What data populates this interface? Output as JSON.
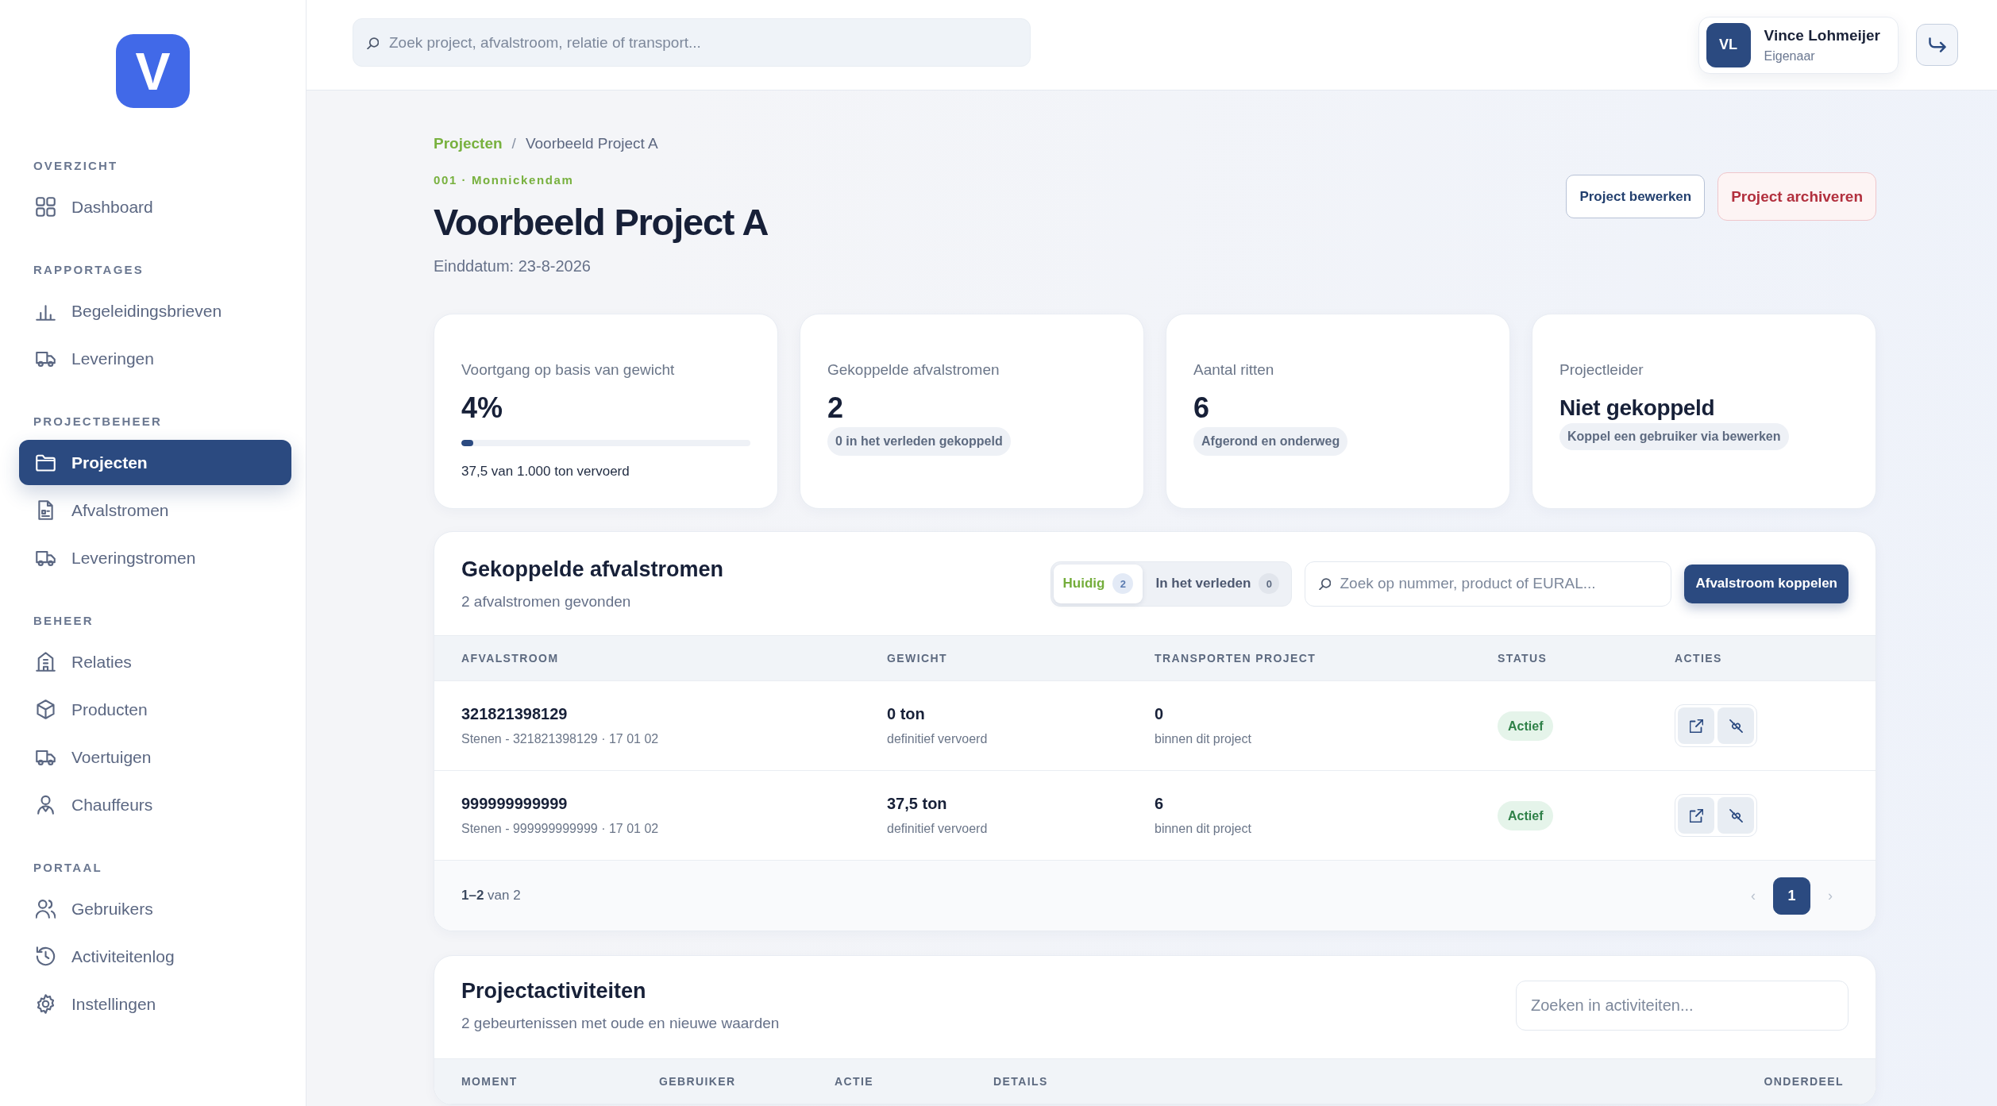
{
  "sidebar": {
    "logo": "V",
    "sections": [
      {
        "title": "OVERZICHT",
        "items": [
          {
            "label": "Dashboard",
            "selected": false
          }
        ]
      },
      {
        "title": "RAPPORTAGES",
        "items": [
          {
            "label": "Begeleidingsbrieven",
            "selected": false
          },
          {
            "label": "Leveringen",
            "selected": false
          }
        ]
      },
      {
        "title": "PROJECTBEHEER",
        "items": [
          {
            "label": "Projecten",
            "selected": true
          },
          {
            "label": "Afvalstromen",
            "selected": false
          },
          {
            "label": "Leveringstromen",
            "selected": false
          }
        ]
      },
      {
        "title": "BEHEER",
        "items": [
          {
            "label": "Relaties",
            "selected": false
          },
          {
            "label": "Producten",
            "selected": false
          },
          {
            "label": "Voertuigen",
            "selected": false
          },
          {
            "label": "Chauffeurs",
            "selected": false
          }
        ]
      },
      {
        "title": "PORTAAL",
        "items": [
          {
            "label": "Gebruikers",
            "selected": false
          },
          {
            "label": "Activiteitenlog",
            "selected": false
          },
          {
            "label": "Instellingen",
            "selected": false
          }
        ]
      }
    ]
  },
  "topbar": {
    "search": {
      "placeholder": "Zoek project, afvalstroom, relatie of transport..."
    },
    "user": {
      "initials": "VL",
      "name": "Vince Lohmeijer",
      "role": "Eigenaar"
    }
  },
  "breadcrumb": {
    "items": [
      "Projecten",
      "Voorbeeld Project A"
    ],
    "separator": "/"
  },
  "project": {
    "code": "001 · Monnickendam",
    "title": "Voorbeeld Project A",
    "end_date": "Einddatum: 23-8-2026",
    "actions": [
      {
        "label": "Project bewerken",
        "kind": "secondary"
      },
      {
        "label": "Project archiveren",
        "kind": "danger"
      }
    ]
  },
  "stats": [
    {
      "kind": "progress",
      "label": "Voortgang op basis van gewicht",
      "value": "4%",
      "level": 0.04,
      "note": "37,5 van 1.000 ton vervoerd"
    },
    {
      "kind": "count",
      "label": "Gekoppelde afvalstromen",
      "value": "2",
      "pill": "0 in het verleden gekoppeld"
    },
    {
      "kind": "count",
      "label": "Aantal ritten",
      "value": "6",
      "pill": "Afgerond en onderweg"
    },
    {
      "kind": "text",
      "label": "Projectleider",
      "value": "Niet gekoppeld",
      "pill": "Koppel een gebruiker via bewerken"
    }
  ],
  "waste_streams": {
    "title": "Gekoppelde afvalstromen",
    "subtitle": "2 afvalstromen gevonden",
    "tabs": [
      {
        "label": "Huidig",
        "count": "2",
        "selected": true
      },
      {
        "label": "In het verleden",
        "count": "0",
        "selected": false
      }
    ],
    "search": {
      "placeholder": "Zoek op nummer, product of EURAL..."
    },
    "button": "Afvalstroom koppelen",
    "columns": [
      "AFVALSTROOM",
      "GEWICHT",
      "TRANSPORTEN PROJECT",
      "STATUS",
      "ACTIES"
    ],
    "rows": [
      {
        "number": "321821398129",
        "description": "Stenen - 321821398129 · 17 01 02",
        "weight": "0 ton",
        "weight_note": "definitief vervoerd",
        "transports": "0",
        "transports_note": "binnen dit project",
        "status": "Actief"
      },
      {
        "number": "999999999999",
        "description": "Stenen - 999999999999 · 17 01 02",
        "weight": "37,5 ton",
        "weight_note": "definitief vervoerd",
        "transports": "6",
        "transports_note": "binnen dit project",
        "status": "Actief"
      }
    ],
    "footer": {
      "range": "**1–2** van 2",
      "prev": {
        "label": "‹",
        "disabled": true
      },
      "pages": [
        {
          "label": "1",
          "selected": true
        }
      ],
      "next": {
        "label": "›",
        "disabled": true
      }
    }
  },
  "activities": {
    "title": "Projectactiviteiten",
    "subtitle": "2 gebeurtenissen met oude en nieuwe waarden",
    "search": {
      "placeholder": "Zoeken in activiteiten..."
    },
    "columns": [
      "MOMENT",
      "GEBRUIKER",
      "ACTIE",
      "DETAILS",
      "ONDERDEEL"
    ]
  }
}
